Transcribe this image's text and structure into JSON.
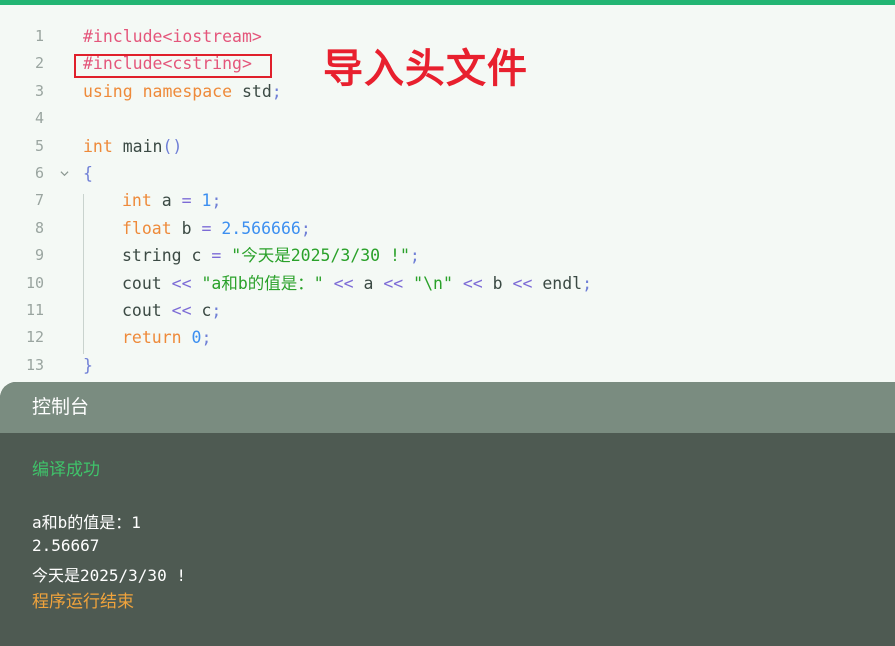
{
  "annotation": {
    "text": "导入头文件"
  },
  "code_lines": [
    {
      "n": "1",
      "parts": [
        {
          "t": "#include<iostream>",
          "c": "pre"
        }
      ]
    },
    {
      "n": "2",
      "parts": [
        {
          "t": "#include<cstring>",
          "c": "pre"
        }
      ]
    },
    {
      "n": "3",
      "parts": [
        {
          "t": "using",
          "c": "kw"
        },
        {
          "t": " ",
          "c": "id"
        },
        {
          "t": "namespace",
          "c": "kw"
        },
        {
          "t": " std",
          "c": "id"
        },
        {
          "t": ";",
          "c": "punc"
        }
      ]
    },
    {
      "n": "4",
      "parts": []
    },
    {
      "n": "5",
      "parts": [
        {
          "t": "int",
          "c": "type"
        },
        {
          "t": " main",
          "c": "id"
        },
        {
          "t": "()",
          "c": "punc"
        }
      ]
    },
    {
      "n": "6",
      "parts": [
        {
          "t": "{",
          "c": "punc"
        }
      ]
    },
    {
      "n": "7",
      "parts": [
        {
          "t": "int",
          "c": "type"
        },
        {
          "t": " a ",
          "c": "id"
        },
        {
          "t": "=",
          "c": "op"
        },
        {
          "t": " ",
          "c": "id"
        },
        {
          "t": "1",
          "c": "num"
        },
        {
          "t": ";",
          "c": "punc"
        }
      ]
    },
    {
      "n": "8",
      "parts": [
        {
          "t": "float",
          "c": "type"
        },
        {
          "t": " b ",
          "c": "id"
        },
        {
          "t": "=",
          "c": "op"
        },
        {
          "t": " ",
          "c": "id"
        },
        {
          "t": "2.566666",
          "c": "num"
        },
        {
          "t": ";",
          "c": "punc"
        }
      ]
    },
    {
      "n": "9",
      "parts": [
        {
          "t": "string c ",
          "c": "id"
        },
        {
          "t": "=",
          "c": "op"
        },
        {
          "t": " ",
          "c": "id"
        },
        {
          "t": "\"今天是2025/3/30 !\"",
          "c": "str"
        },
        {
          "t": ";",
          "c": "punc"
        }
      ]
    },
    {
      "n": "10",
      "parts": [
        {
          "t": "cout ",
          "c": "id"
        },
        {
          "t": "<<",
          "c": "op"
        },
        {
          "t": " ",
          "c": "id"
        },
        {
          "t": "\"a和b的值是：\"",
          "c": "str"
        },
        {
          "t": " ",
          "c": "id"
        },
        {
          "t": "<<",
          "c": "op"
        },
        {
          "t": " a ",
          "c": "id"
        },
        {
          "t": "<<",
          "c": "op"
        },
        {
          "t": " ",
          "c": "id"
        },
        {
          "t": "\"\\n\"",
          "c": "str"
        },
        {
          "t": " ",
          "c": "id"
        },
        {
          "t": "<<",
          "c": "op"
        },
        {
          "t": " b ",
          "c": "id"
        },
        {
          "t": "<<",
          "c": "op"
        },
        {
          "t": " endl",
          "c": "id"
        },
        {
          "t": ";",
          "c": "punc"
        }
      ]
    },
    {
      "n": "11",
      "parts": [
        {
          "t": "cout ",
          "c": "id"
        },
        {
          "t": "<<",
          "c": "op"
        },
        {
          "t": " c",
          "c": "id"
        },
        {
          "t": ";",
          "c": "punc"
        }
      ]
    },
    {
      "n": "12",
      "parts": [
        {
          "t": "return",
          "c": "kw"
        },
        {
          "t": " ",
          "c": "id"
        },
        {
          "t": "0",
          "c": "num"
        },
        {
          "t": ";",
          "c": "punc"
        }
      ]
    },
    {
      "n": "13",
      "parts": [
        {
          "t": "}",
          "c": "punc"
        }
      ]
    }
  ],
  "console": {
    "title": "控制台",
    "status": "编译成功",
    "output": [
      "a和b的值是：1",
      "2.56667",
      "今天是2025/3/30 !"
    ],
    "end": "程序运行结束"
  },
  "colors": {
    "accent": "#22b573",
    "highlight_box": "#e0202b",
    "annotation": "#e8202e",
    "console_bg": "#4e5a52",
    "console_header": "#7a8c80",
    "success": "#3fc36a",
    "end": "#f0a33c"
  },
  "icons": {
    "fold": "chevron-down-icon"
  }
}
